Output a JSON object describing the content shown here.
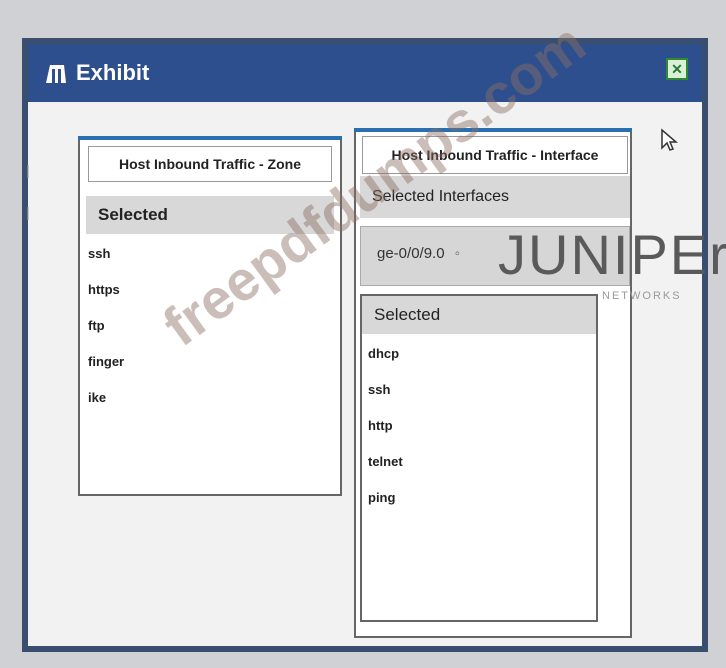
{
  "window": {
    "title": "Exhibit",
    "close_glyph": "✕"
  },
  "zone_panel": {
    "header": "Host Inbound Traffic - Zone",
    "section_label": "Selected",
    "items": [
      "ssh",
      "https",
      "ftp",
      "finger",
      "ike"
    ]
  },
  "interface_panel": {
    "header": "Host Inbound Traffic - Interface",
    "section_label": "Selected Interfaces",
    "interface_value": "ge-0/0/9.0",
    "sub_section_label": "Selected",
    "items": [
      "dhcp",
      "ssh",
      "http",
      "telnet",
      "ping"
    ]
  },
  "branding": {
    "logo": "JUNIPEr",
    "logo_sub": "NETWORKS",
    "watermark": "freepdfdumps.com"
  },
  "icons": {
    "title_icon": "exhibit-icon",
    "close_icon": "close-icon",
    "cursor": "mouse-pointer-icon"
  },
  "colors": {
    "titlebar": "#2d4f8e",
    "frame": "#3a4f70",
    "accent_line": "#2a6fb0",
    "close_border": "#2f8a2f"
  }
}
